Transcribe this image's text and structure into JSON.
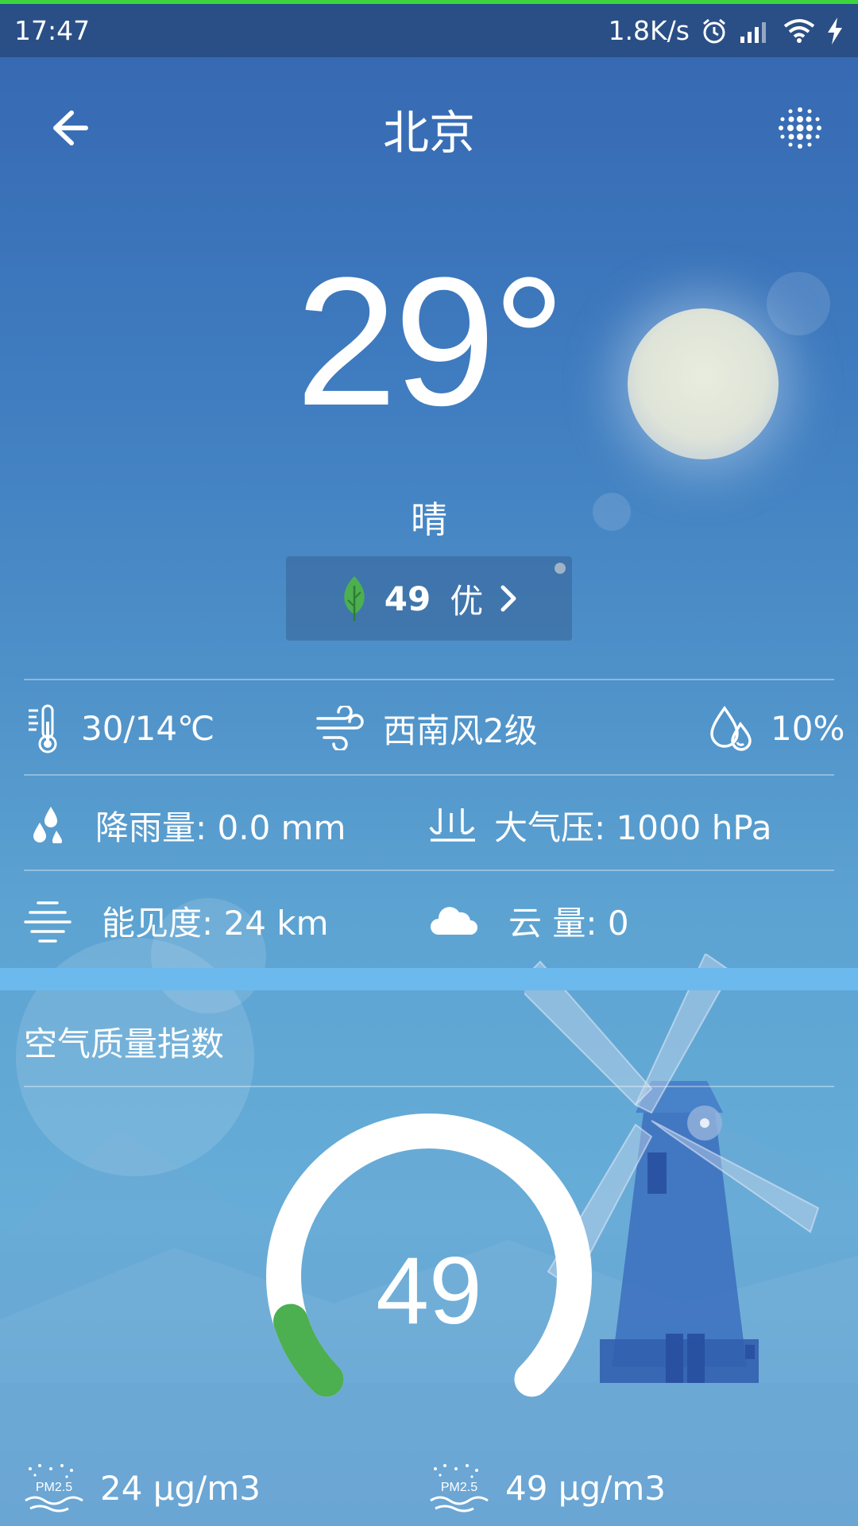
{
  "status_bar": {
    "time": "17:47",
    "net_speed": "1.8K/s"
  },
  "header": {
    "city": "北京"
  },
  "weather": {
    "temperature": "29°",
    "condition": "晴",
    "aqi_value": "49",
    "aqi_level": "优"
  },
  "details": {
    "temp_range": "30/14℃",
    "wind": "西南风2级",
    "humidity": "10%",
    "precip_label": "降雨量: 0.0 mm",
    "pressure_label": "大气压: 1000 hPa",
    "visibility_label": "能见度: 24 km",
    "cloud_label": "云  量: 0"
  },
  "air_quality": {
    "section_title": "空气质量指数",
    "gauge_value": "49",
    "gauge_fraction": 0.1,
    "pm25_label": "PM2.5",
    "pm25_value": "24 μg/m3",
    "pm10_label": "PM2.5",
    "pm10_value": "49 μg/m3"
  },
  "colors": {
    "status_bar": "#2a4f86",
    "top_line": "#3cd63c",
    "aqi_good": "#4caf50",
    "band": "#6cb9ee"
  },
  "icons": [
    "back-arrow-icon",
    "dots-menu-icon",
    "leaf-icon",
    "chevron-right-icon",
    "thermometer-icon",
    "wind-icon",
    "humidity-icon",
    "rain-drops-icon",
    "pressure-icon",
    "visibility-icon",
    "cloud-icon",
    "pm25-icon"
  ]
}
